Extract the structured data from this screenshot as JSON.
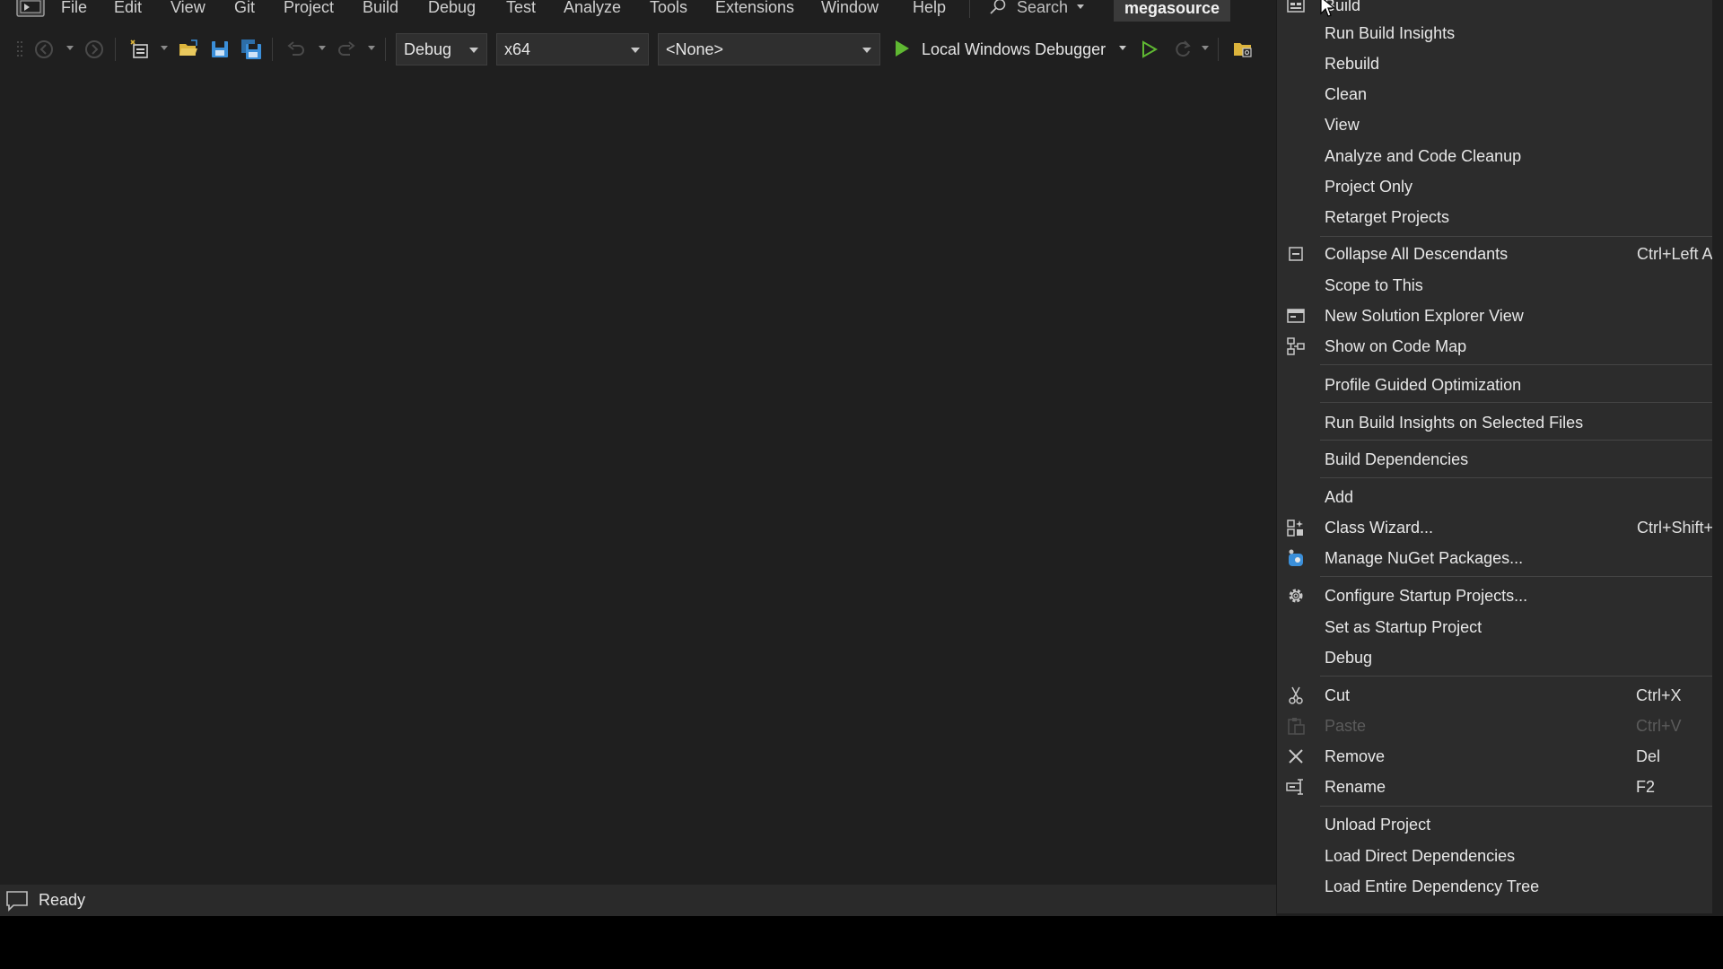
{
  "menubar": {
    "items": [
      {
        "label": "File"
      },
      {
        "label": "Edit"
      },
      {
        "label": "View"
      },
      {
        "label": "Git"
      },
      {
        "label": "Project"
      },
      {
        "label": "Build"
      },
      {
        "label": "Debug"
      },
      {
        "label": "Test"
      },
      {
        "label": "Analyze"
      },
      {
        "label": "Tools"
      },
      {
        "label": "Extensions"
      },
      {
        "label": "Window"
      },
      {
        "label": "Help"
      }
    ],
    "search_label": "Search",
    "solution_name": "megasource"
  },
  "toolbar": {
    "configuration": "Debug",
    "platform": "x64",
    "startup_item": "<None>",
    "debugger_label": "Local Windows Debugger",
    "accent_green": "#5fb832",
    "accent_blue": "#3b8fd9",
    "accent_folder": "#dcb43c"
  },
  "statusbar": {
    "text": "Ready"
  },
  "context_menu": {
    "items": [
      {
        "label": "Build",
        "shortcut": "",
        "icon": "build-icon",
        "disabled": false
      },
      {
        "label": "Run Build Insights",
        "shortcut": "",
        "icon": "",
        "disabled": false
      },
      {
        "label": "Rebuild",
        "shortcut": "",
        "icon": "",
        "disabled": false
      },
      {
        "label": "Clean",
        "shortcut": "",
        "icon": "",
        "disabled": false
      },
      {
        "label": "View",
        "shortcut": "",
        "icon": "",
        "disabled": false
      },
      {
        "label": "Analyze and Code Cleanup",
        "shortcut": "",
        "icon": "",
        "disabled": false
      },
      {
        "label": "Project Only",
        "shortcut": "",
        "icon": "",
        "disabled": false
      },
      {
        "label": "Retarget Projects",
        "shortcut": "",
        "icon": "",
        "disabled": false
      },
      {
        "label": "Collapse All Descendants",
        "shortcut": "Ctrl+Left A",
        "icon": "collapse-icon",
        "disabled": false
      },
      {
        "label": "Scope to This",
        "shortcut": "",
        "icon": "",
        "disabled": false
      },
      {
        "label": "New Solution Explorer View",
        "shortcut": "",
        "icon": "new-view-icon",
        "disabled": false
      },
      {
        "label": "Show on Code Map",
        "shortcut": "",
        "icon": "code-map-icon",
        "disabled": false
      },
      {
        "label": "Profile Guided Optimization",
        "shortcut": "",
        "icon": "",
        "disabled": false
      },
      {
        "label": "Run Build Insights on Selected Files",
        "shortcut": "",
        "icon": "",
        "disabled": false
      },
      {
        "label": "Build Dependencies",
        "shortcut": "",
        "icon": "",
        "disabled": false
      },
      {
        "label": "Add",
        "shortcut": "",
        "icon": "",
        "disabled": false
      },
      {
        "label": "Class Wizard...",
        "shortcut": "Ctrl+Shift+",
        "icon": "class-wizard-icon",
        "disabled": false
      },
      {
        "label": "Manage NuGet Packages...",
        "shortcut": "",
        "icon": "nuget-icon",
        "disabled": false
      },
      {
        "label": "Configure Startup Projects...",
        "shortcut": "",
        "icon": "gear-icon",
        "disabled": false
      },
      {
        "label": "Set as Startup Project",
        "shortcut": "",
        "icon": "",
        "disabled": false
      },
      {
        "label": "Debug",
        "shortcut": "",
        "icon": "",
        "disabled": false
      },
      {
        "label": "Cut",
        "shortcut": "Ctrl+X",
        "icon": "cut-icon",
        "disabled": false
      },
      {
        "label": "Paste",
        "shortcut": "Ctrl+V",
        "icon": "paste-icon",
        "disabled": true
      },
      {
        "label": "Remove",
        "shortcut": "Del",
        "icon": "remove-icon",
        "disabled": false
      },
      {
        "label": "Rename",
        "shortcut": "F2",
        "icon": "rename-icon",
        "disabled": false
      },
      {
        "label": "Unload Project",
        "shortcut": "",
        "icon": "",
        "disabled": false
      },
      {
        "label": "Load Direct Dependencies",
        "shortcut": "",
        "icon": "",
        "disabled": false
      },
      {
        "label": "Load Entire Dependency Tree",
        "shortcut": "",
        "icon": "",
        "disabled": false
      }
    ]
  }
}
